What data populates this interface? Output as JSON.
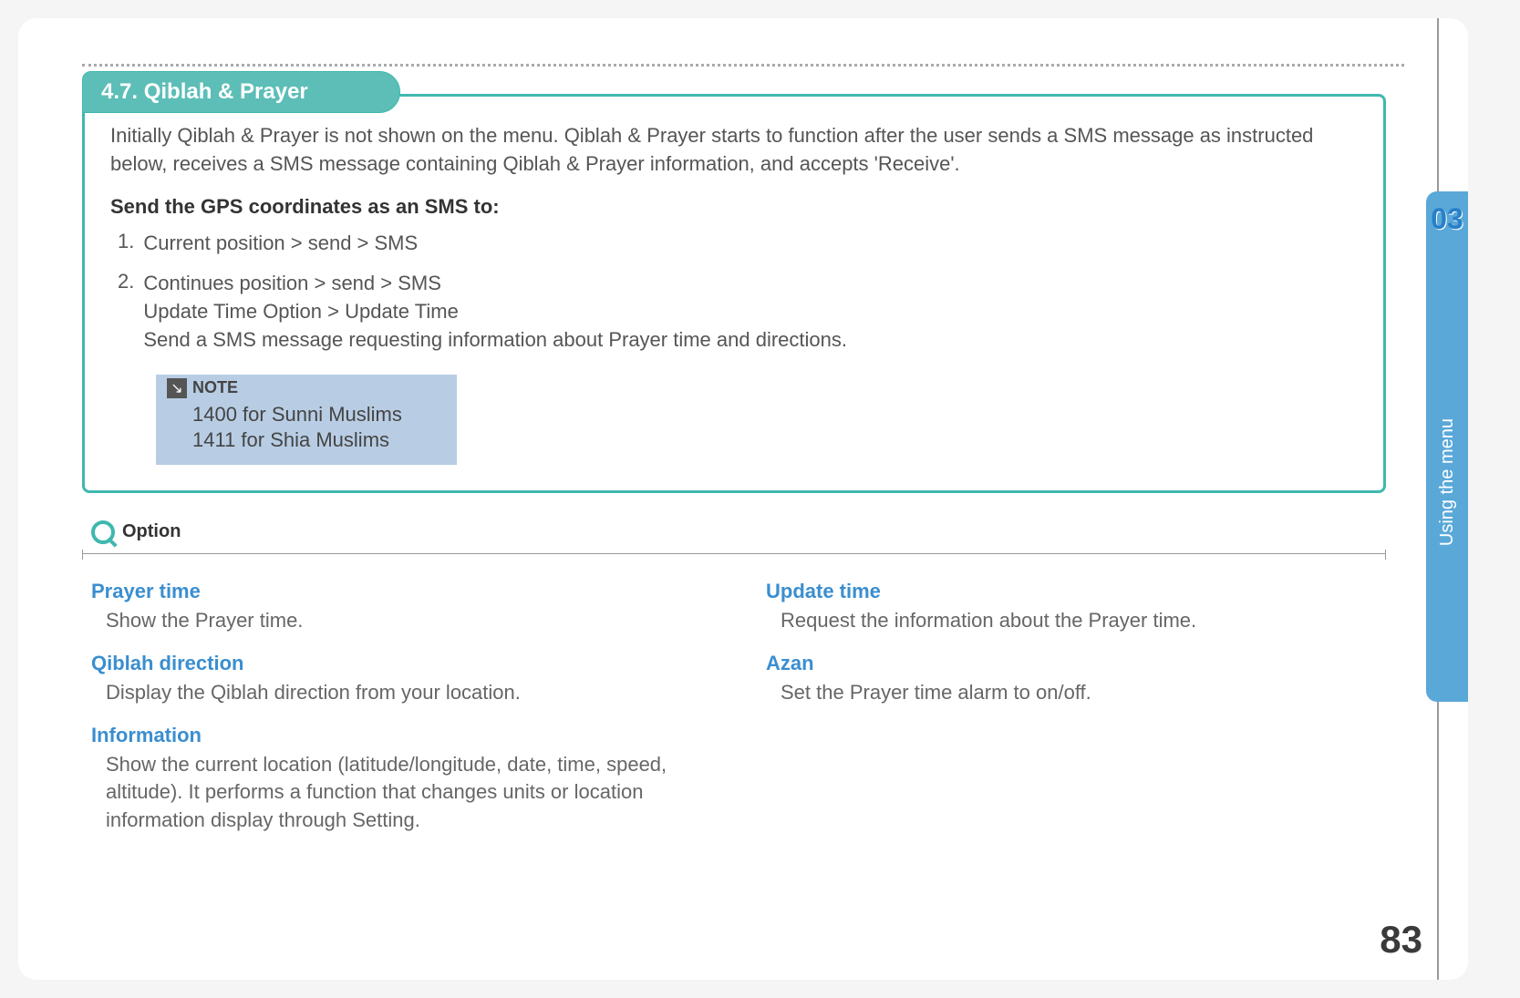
{
  "chapter": {
    "number": "03",
    "label": "Using the menu"
  },
  "page_number": "83",
  "section": {
    "title": "4.7. Qiblah & Prayer"
  },
  "intro": "Initially Qiblah & Prayer is not shown on the menu. Qiblah & Prayer starts to function after the user sends a SMS message as instructed below, receives a SMS message containing Qiblah & Prayer information, and accepts 'Receive'.",
  "sms_heading": "Send the GPS coordinates as an SMS to:",
  "steps": [
    {
      "num": "1.",
      "text": "Current position > send > SMS"
    },
    {
      "num": "2.",
      "text": "Continues position > send > SMS\nUpdate Time Option > Update Time\nSend a SMS message requesting information about Prayer time and directions."
    }
  ],
  "note": {
    "label": "NOTE",
    "line1": "1400 for Sunni Muslims",
    "line2": "1411 for Shia Muslims"
  },
  "option_heading": "Option",
  "options_left": [
    {
      "title": "Prayer time",
      "desc": "Show the Prayer time."
    },
    {
      "title": "Qiblah direction",
      "desc": "Display the Qiblah direction from your location."
    },
    {
      "title": "Information",
      "desc": "Show the current location (latitude/longitude, date, time, speed, altitude). It performs a function that changes units or location information display through Setting."
    }
  ],
  "options_right": [
    {
      "title": "Update time",
      "desc": "Request the information about the Prayer time."
    },
    {
      "title": "Azan",
      "desc": "Set the Prayer time alarm to on/off."
    }
  ]
}
